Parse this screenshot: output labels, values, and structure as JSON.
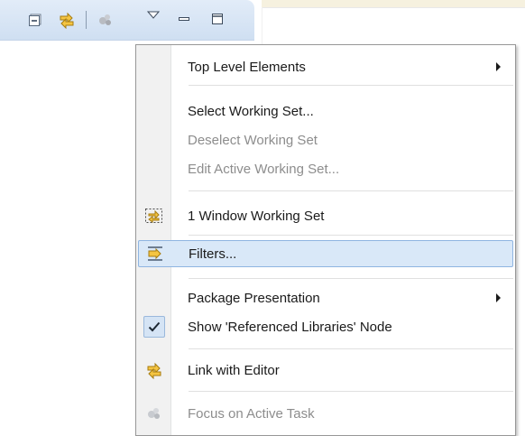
{
  "menu": {
    "items": [
      {
        "label": "Top Level Elements",
        "icon": "",
        "submenu": true,
        "enabled": true
      },
      {
        "label": "Select Working Set...",
        "icon": "",
        "submenu": false,
        "enabled": true
      },
      {
        "label": "Deselect Working Set",
        "icon": "",
        "submenu": false,
        "enabled": false
      },
      {
        "label": "Edit Active Working Set...",
        "icon": "",
        "submenu": false,
        "enabled": false
      },
      {
        "label": "1 Window Working Set",
        "icon": "window-working-set-icon",
        "submenu": false,
        "enabled": true
      },
      {
        "label": "Filters...",
        "icon": "filters-icon",
        "submenu": false,
        "enabled": true,
        "highlighted": true
      },
      {
        "label": "Package Presentation",
        "icon": "",
        "submenu": true,
        "enabled": true
      },
      {
        "label": "Show 'Referenced Libraries' Node",
        "icon": "check-icon",
        "submenu": false,
        "enabled": true,
        "checked": true
      },
      {
        "label": "Link with Editor",
        "icon": "link-with-editor-icon",
        "submenu": false,
        "enabled": true
      },
      {
        "label": "Focus on Active Task",
        "icon": "focus-task-icon",
        "submenu": false,
        "enabled": false
      }
    ]
  },
  "toolbar": {
    "icons": [
      "collapse-all-icon",
      "link-with-editor-icon",
      "focus-task-icon",
      "view-menu-icon",
      "minimize-icon",
      "maximize-icon"
    ]
  },
  "colors": {
    "highlight": "#d9e8f8",
    "highlight_border": "#8fb5e1",
    "disabled_text": "#8d8d8d",
    "toolbar_bg": "#d8e5f5"
  }
}
